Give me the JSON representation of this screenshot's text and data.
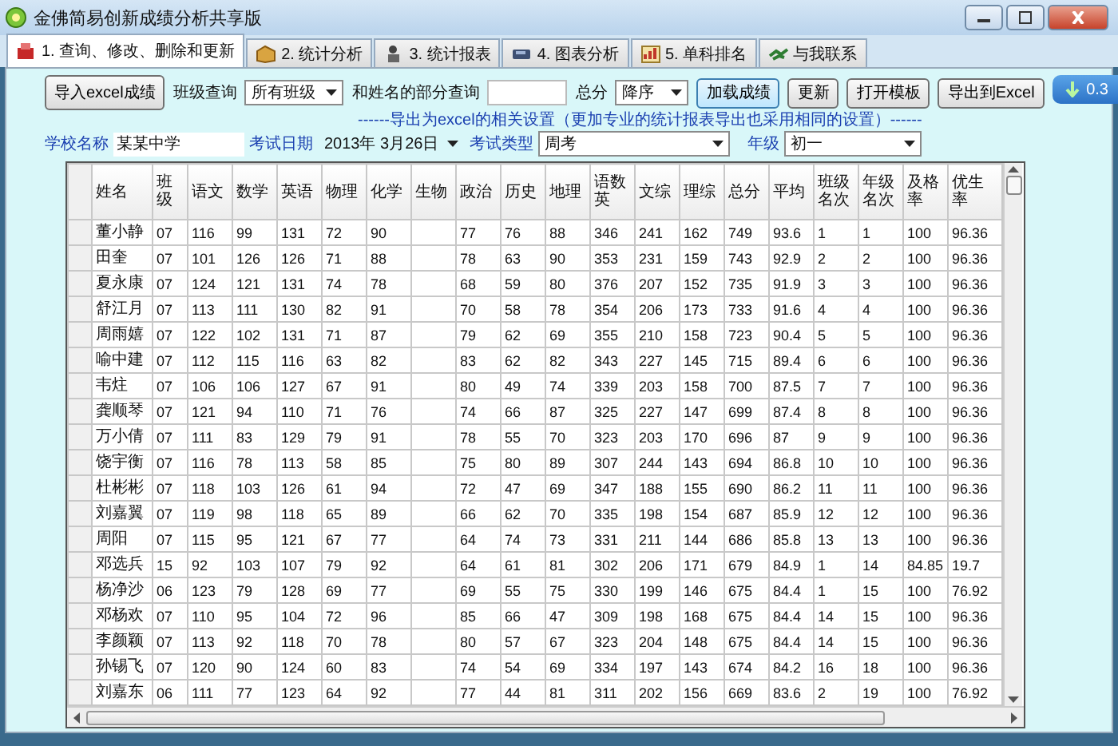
{
  "window": {
    "title": "金佛简易创新成绩分析共享版"
  },
  "tabs": [
    {
      "label": "1. 查询、修改、删除和更新",
      "selected": true,
      "kind": "brick"
    },
    {
      "label": "2. 统计分析",
      "selected": false,
      "kind": "box"
    },
    {
      "label": "3. 统计报表",
      "selected": false,
      "kind": "figure"
    },
    {
      "label": "4. 图表分析",
      "selected": false,
      "kind": "disk"
    },
    {
      "label": "5. 单科排名",
      "selected": false,
      "kind": "chart"
    },
    {
      "label": "与我联系",
      "selected": false,
      "kind": "handshake"
    }
  ],
  "toolbar": {
    "import_button": "导入excel成绩",
    "class_filter": {
      "label": "班级查询",
      "value": "所有班级"
    },
    "name_search": {
      "label": "和姓名的部分查询"
    },
    "total_sort": {
      "label": "总分",
      "value": "降序"
    },
    "buttons": [
      {
        "label": "加载成绩",
        "focused": true
      },
      {
        "label": "更新",
        "focused": false
      },
      {
        "label": "打开模板",
        "focused": false
      },
      {
        "label": "导出到Excel",
        "focused": false
      }
    ]
  },
  "export_note": "------导出为excel的相关设置（更加专业的统计报表导出也采用相同的设置）------",
  "export_settings": {
    "school": {
      "label": "学校名称",
      "value": "某某中学"
    },
    "exam_date": {
      "label": "考试日期",
      "value": "2013年 3月26日"
    },
    "exam_type": {
      "label": "考试类型",
      "value": "周考"
    },
    "grade": {
      "label": "年级",
      "value": "初一"
    }
  },
  "download_badge": "0.3",
  "table": {
    "columns": [
      "姓名",
      "班级",
      "语文",
      "数学",
      "英语",
      "物理",
      "化学",
      "生物",
      "政治",
      "历史",
      "地理",
      "语数英",
      "文综",
      "理综",
      "总分",
      "平均",
      "班级名次",
      "年级名次",
      "及格率",
      "优生率"
    ],
    "rows": [
      [
        "董小静",
        "07",
        "116",
        "99",
        "131",
        "72",
        "90",
        "",
        "77",
        "76",
        "88",
        "346",
        "241",
        "162",
        "749",
        "93.6",
        "1",
        "1",
        "100",
        "96.36"
      ],
      [
        "田奎",
        "07",
        "101",
        "126",
        "126",
        "71",
        "88",
        "",
        "78",
        "63",
        "90",
        "353",
        "231",
        "159",
        "743",
        "92.9",
        "2",
        "2",
        "100",
        "96.36"
      ],
      [
        "夏永康",
        "07",
        "124",
        "121",
        "131",
        "74",
        "78",
        "",
        "68",
        "59",
        "80",
        "376",
        "207",
        "152",
        "735",
        "91.9",
        "3",
        "3",
        "100",
        "96.36"
      ],
      [
        "舒江月",
        "07",
        "113",
        "111",
        "130",
        "82",
        "91",
        "",
        "70",
        "58",
        "78",
        "354",
        "206",
        "173",
        "733",
        "91.6",
        "4",
        "4",
        "100",
        "96.36"
      ],
      [
        "周雨嬉",
        "07",
        "122",
        "102",
        "131",
        "71",
        "87",
        "",
        "79",
        "62",
        "69",
        "355",
        "210",
        "158",
        "723",
        "90.4",
        "5",
        "5",
        "100",
        "96.36"
      ],
      [
        "喻中建",
        "07",
        "112",
        "115",
        "116",
        "63",
        "82",
        "",
        "83",
        "62",
        "82",
        "343",
        "227",
        "145",
        "715",
        "89.4",
        "6",
        "6",
        "100",
        "96.36"
      ],
      [
        "韦炷",
        "07",
        "106",
        "106",
        "127",
        "67",
        "91",
        "",
        "80",
        "49",
        "74",
        "339",
        "203",
        "158",
        "700",
        "87.5",
        "7",
        "7",
        "100",
        "96.36"
      ],
      [
        "龚顺琴",
        "07",
        "121",
        "94",
        "110",
        "71",
        "76",
        "",
        "74",
        "66",
        "87",
        "325",
        "227",
        "147",
        "699",
        "87.4",
        "8",
        "8",
        "100",
        "96.36"
      ],
      [
        "万小倩",
        "07",
        "111",
        "83",
        "129",
        "79",
        "91",
        "",
        "78",
        "55",
        "70",
        "323",
        "203",
        "170",
        "696",
        "87",
        "9",
        "9",
        "100",
        "96.36"
      ],
      [
        "饶宇衡",
        "07",
        "116",
        "78",
        "113",
        "58",
        "85",
        "",
        "75",
        "80",
        "89",
        "307",
        "244",
        "143",
        "694",
        "86.8",
        "10",
        "10",
        "100",
        "96.36"
      ],
      [
        "杜彬彬",
        "07",
        "118",
        "103",
        "126",
        "61",
        "94",
        "",
        "72",
        "47",
        "69",
        "347",
        "188",
        "155",
        "690",
        "86.2",
        "11",
        "11",
        "100",
        "96.36"
      ],
      [
        "刘嘉翼",
        "07",
        "119",
        "98",
        "118",
        "65",
        "89",
        "",
        "66",
        "62",
        "70",
        "335",
        "198",
        "154",
        "687",
        "85.9",
        "12",
        "12",
        "100",
        "96.36"
      ],
      [
        "周阳",
        "07",
        "115",
        "95",
        "121",
        "67",
        "77",
        "",
        "64",
        "74",
        "73",
        "331",
        "211",
        "144",
        "686",
        "85.8",
        "13",
        "13",
        "100",
        "96.36"
      ],
      [
        "邓选兵",
        "15",
        "92",
        "103",
        "107",
        "79",
        "92",
        "",
        "64",
        "61",
        "81",
        "302",
        "206",
        "171",
        "679",
        "84.9",
        "1",
        "14",
        "84.85",
        "19.7"
      ],
      [
        "杨净沙",
        "06",
        "123",
        "79",
        "128",
        "69",
        "77",
        "",
        "69",
        "55",
        "75",
        "330",
        "199",
        "146",
        "675",
        "84.4",
        "1",
        "15",
        "100",
        "76.92"
      ],
      [
        "邓杨欢",
        "07",
        "110",
        "95",
        "104",
        "72",
        "96",
        "",
        "85",
        "66",
        "47",
        "309",
        "198",
        "168",
        "675",
        "84.4",
        "14",
        "15",
        "100",
        "96.36"
      ],
      [
        "李颜颖",
        "07",
        "113",
        "92",
        "118",
        "70",
        "78",
        "",
        "80",
        "57",
        "67",
        "323",
        "204",
        "148",
        "675",
        "84.4",
        "14",
        "15",
        "100",
        "96.36"
      ],
      [
        "孙锡飞",
        "07",
        "120",
        "90",
        "124",
        "60",
        "83",
        "",
        "74",
        "54",
        "69",
        "334",
        "197",
        "143",
        "674",
        "84.2",
        "16",
        "18",
        "100",
        "96.36"
      ],
      [
        "刘嘉东",
        "06",
        "111",
        "77",
        "123",
        "64",
        "92",
        "",
        "77",
        "44",
        "81",
        "311",
        "202",
        "156",
        "669",
        "83.6",
        "2",
        "19",
        "100",
        "76.92"
      ]
    ]
  }
}
